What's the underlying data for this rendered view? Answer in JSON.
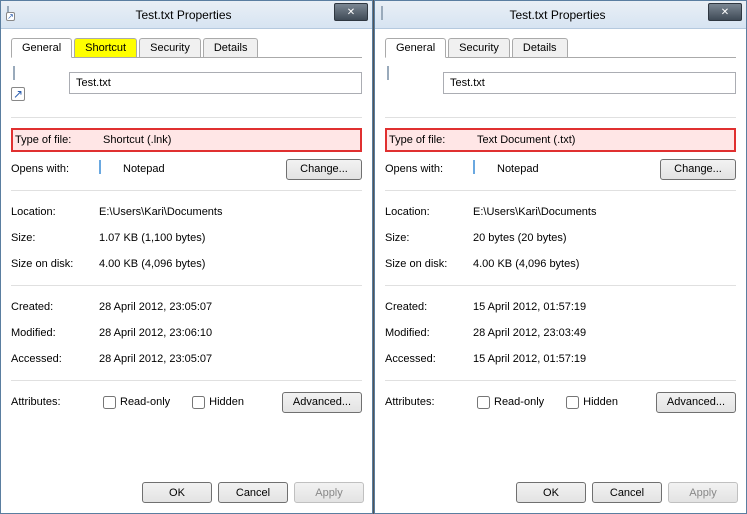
{
  "windows": [
    {
      "title": "Test.txt Properties",
      "tabs": [
        {
          "label": "General",
          "active": true,
          "highlight": null
        },
        {
          "label": "Shortcut",
          "active": false,
          "highlight": "yellow"
        },
        {
          "label": "Security",
          "active": false,
          "highlight": null
        },
        {
          "label": "Details",
          "active": false,
          "highlight": null
        }
      ],
      "icon_overlay": "shortcut",
      "filename": "Test.txt",
      "type_of_file_label": "Type of file:",
      "type_of_file_value": "Shortcut (.lnk)",
      "opens_with_label": "Opens with:",
      "opens_with_app": "Notepad",
      "change_label": "Change...",
      "location_label": "Location:",
      "location_value": "E:\\Users\\Kari\\Documents",
      "size_label": "Size:",
      "size_value": "1.07 KB (1,100 bytes)",
      "size_on_disk_label": "Size on disk:",
      "size_on_disk_value": "4.00 KB (4,096 bytes)",
      "created_label": "Created:",
      "created_value": "28 April 2012, 23:05:07",
      "modified_label": "Modified:",
      "modified_value": "28 April 2012, 23:06:10",
      "accessed_label": "Accessed:",
      "accessed_value": "28 April 2012, 23:05:07",
      "attributes_label": "Attributes:",
      "readonly_label": "Read-only",
      "hidden_label": "Hidden",
      "advanced_label": "Advanced...",
      "ok_label": "OK",
      "cancel_label": "Cancel",
      "apply_label": "Apply"
    },
    {
      "title": "Test.txt Properties",
      "tabs": [
        {
          "label": "General",
          "active": true,
          "highlight": null
        },
        {
          "label": "Security",
          "active": false,
          "highlight": null
        },
        {
          "label": "Details",
          "active": false,
          "highlight": null
        }
      ],
      "icon_overlay": null,
      "filename": "Test.txt",
      "type_of_file_label": "Type of file:",
      "type_of_file_value": "Text Document (.txt)",
      "opens_with_label": "Opens with:",
      "opens_with_app": "Notepad",
      "change_label": "Change...",
      "location_label": "Location:",
      "location_value": "E:\\Users\\Kari\\Documents",
      "size_label": "Size:",
      "size_value": "20 bytes (20 bytes)",
      "size_on_disk_label": "Size on disk:",
      "size_on_disk_value": "4.00 KB (4,096 bytes)",
      "created_label": "Created:",
      "created_value": "15 April 2012, 01:57:19",
      "modified_label": "Modified:",
      "modified_value": "28 April 2012, 23:03:49",
      "accessed_label": "Accessed:",
      "accessed_value": "15 April 2012, 01:57:19",
      "attributes_label": "Attributes:",
      "readonly_label": "Read-only",
      "hidden_label": "Hidden",
      "advanced_label": "Advanced...",
      "ok_label": "OK",
      "cancel_label": "Cancel",
      "apply_label": "Apply"
    }
  ]
}
